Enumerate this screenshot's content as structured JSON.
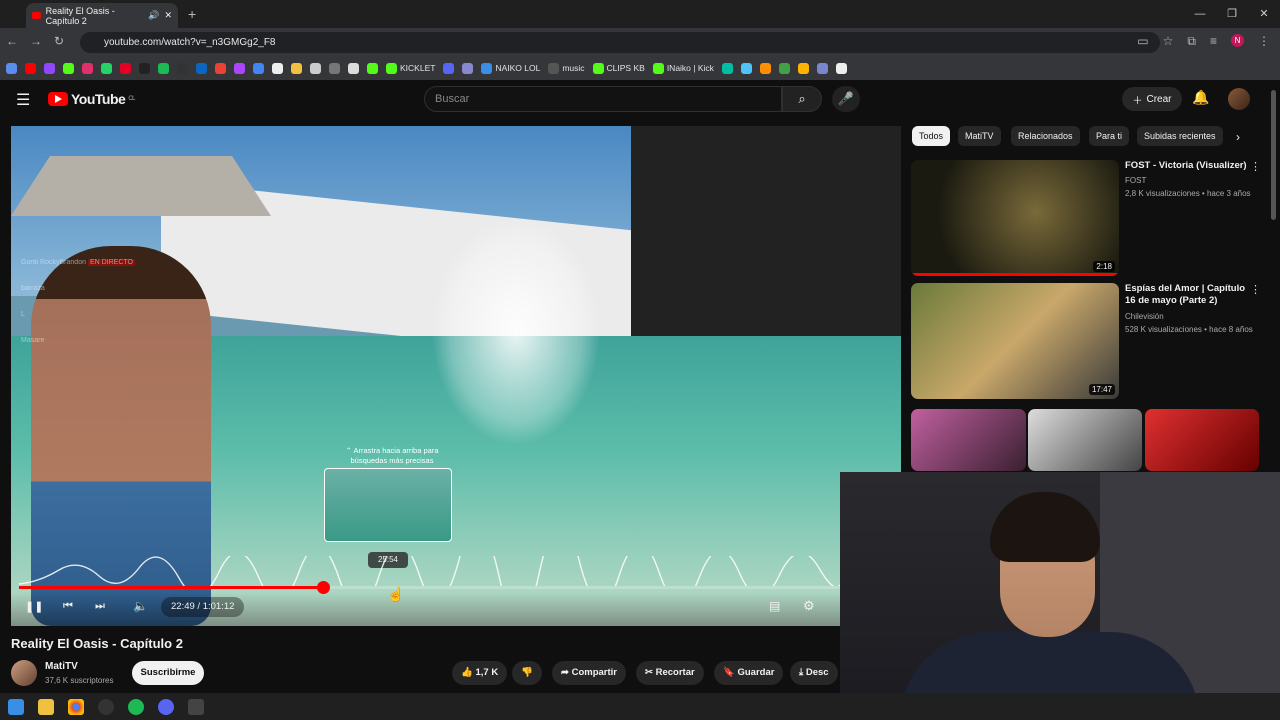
{
  "browser": {
    "tab_title": "Reality El Oasis - Capítulo 2",
    "url": "youtube.com/watch?v=_n3GMGg2_F8",
    "bookmarks": [
      "KICKLET",
      "NAIKO LOL",
      "music",
      "CLIPS KB",
      "INaiko | Kick"
    ]
  },
  "youtube": {
    "logo_text": "YouTube",
    "logo_region": "CL",
    "search_placeholder": "Buscar",
    "create_label": "Crear"
  },
  "player": {
    "chat_user": "Gordi RockyBrandon",
    "chat_live": "EN DIRECTO",
    "chat_lines": [
      "barraza",
      "L",
      "Masare"
    ],
    "drag_hint": "⌃ Arrastra hacia arriba para búsquedas más precisas",
    "preview_time": "25:54",
    "time_display": "22:49 / 1:01:12",
    "progress_fraction": 0.37
  },
  "video": {
    "title": "Reality El Oasis - Capítulo 2",
    "channel": "MatiTV",
    "subscribers": "37,6 K suscriptores",
    "subscribe_label": "Suscribirme",
    "likes": "1,7 K",
    "share_label": "Compartir",
    "clip_label": "Recortar",
    "save_label": "Guardar",
    "download_label": "Desc"
  },
  "sidebar": {
    "chips": [
      "Todos",
      "MatiTV",
      "Relacionados",
      "Para ti",
      "Subidas recientes"
    ],
    "videos": [
      {
        "title": "FOST - Victoria (Visualizer)",
        "channel": "FOST",
        "meta": "2,8 K visualizaciones • hace 3 años",
        "duration": "2:18"
      },
      {
        "title": "Espías del Amor | Capítulo 16 de mayo (Parte 2)",
        "channel": "Chilevisión",
        "meta": "528 K visualizaciones • hace 8 años",
        "duration": "17:47"
      }
    ]
  },
  "colors": {
    "accent": "#ff0000",
    "background": "#0f0f0f"
  }
}
